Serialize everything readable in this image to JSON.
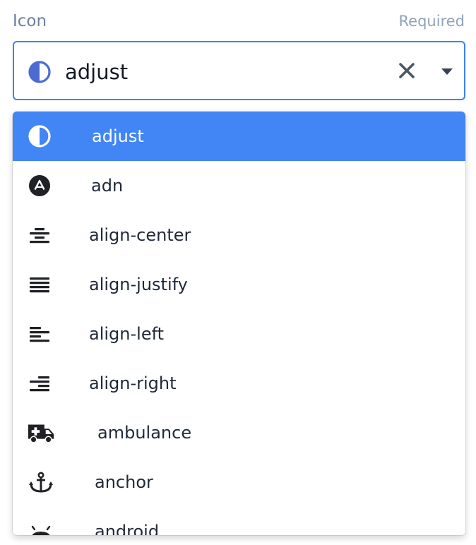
{
  "field": {
    "label": "Icon",
    "required_text": "Required"
  },
  "select": {
    "value": "adjust",
    "icon": "adjust-icon",
    "clear_icon": "close-icon",
    "toggle_icon": "caret-down-icon"
  },
  "options": [
    {
      "label": "adjust",
      "icon": "adjust-icon",
      "selected": true
    },
    {
      "label": "adn",
      "icon": "adn-icon",
      "selected": false
    },
    {
      "label": "align-center",
      "icon": "align-center-icon",
      "selected": false
    },
    {
      "label": "align-justify",
      "icon": "align-justify-icon",
      "selected": false
    },
    {
      "label": "align-left",
      "icon": "align-left-icon",
      "selected": false
    },
    {
      "label": "align-right",
      "icon": "align-right-icon",
      "selected": false
    },
    {
      "label": "ambulance",
      "icon": "ambulance-icon",
      "selected": false
    },
    {
      "label": "anchor",
      "icon": "anchor-icon",
      "selected": false
    },
    {
      "label": "android",
      "icon": "android-icon",
      "selected": false
    }
  ],
  "colors": {
    "accent": "#3b82f6",
    "selected_bg": "#4285f4",
    "label": "#6b7fa3",
    "required": "#8fa2bd",
    "icon_fg": "#1f2124"
  }
}
